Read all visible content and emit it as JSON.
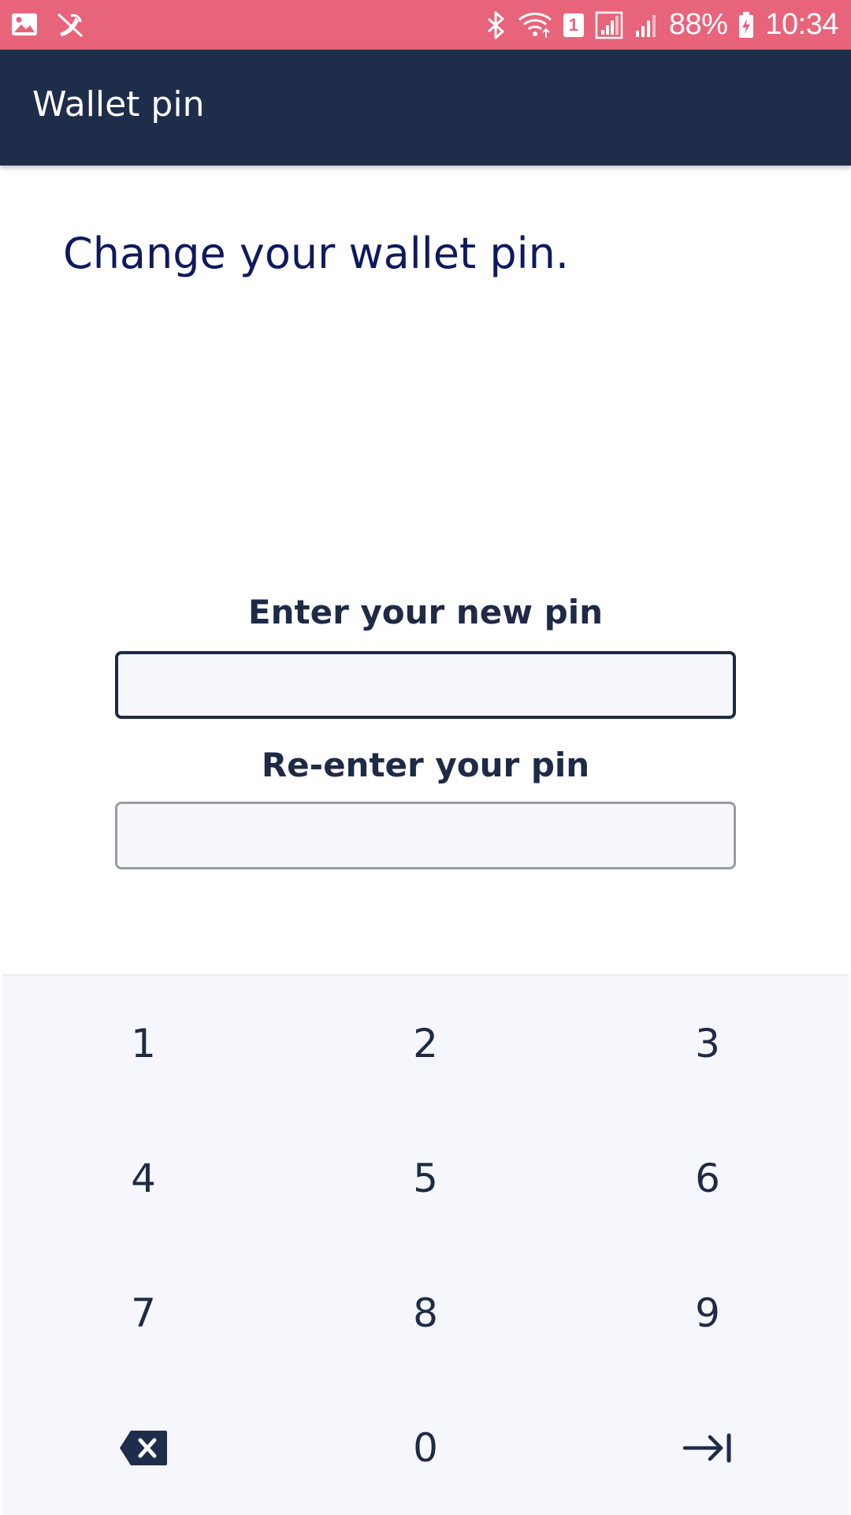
{
  "status_bar": {
    "battery": "88%",
    "time": "10:34",
    "sim_number": "1",
    "bg_color": "#e8647a",
    "icons": [
      "image-icon",
      "mute-icon",
      "bluetooth-icon",
      "wifi-icon",
      "sim-icon",
      "signal-icon",
      "signal-icon",
      "battery-charging-icon"
    ]
  },
  "app_bar": {
    "title": "Wallet pin",
    "bg_color": "#1e2d4a"
  },
  "main": {
    "heading": "Change your wallet pin.",
    "new_pin": {
      "label": "Enter your new pin",
      "value": "",
      "placeholder": ""
    },
    "confirm_pin": {
      "label": "Re-enter your pin",
      "value": "",
      "placeholder": ""
    }
  },
  "keypad": {
    "keys": [
      "1",
      "2",
      "3",
      "4",
      "5",
      "6",
      "7",
      "8",
      "9",
      "0"
    ],
    "delete_icon": "backspace-icon",
    "submit_icon": "tab-arrow-icon"
  }
}
